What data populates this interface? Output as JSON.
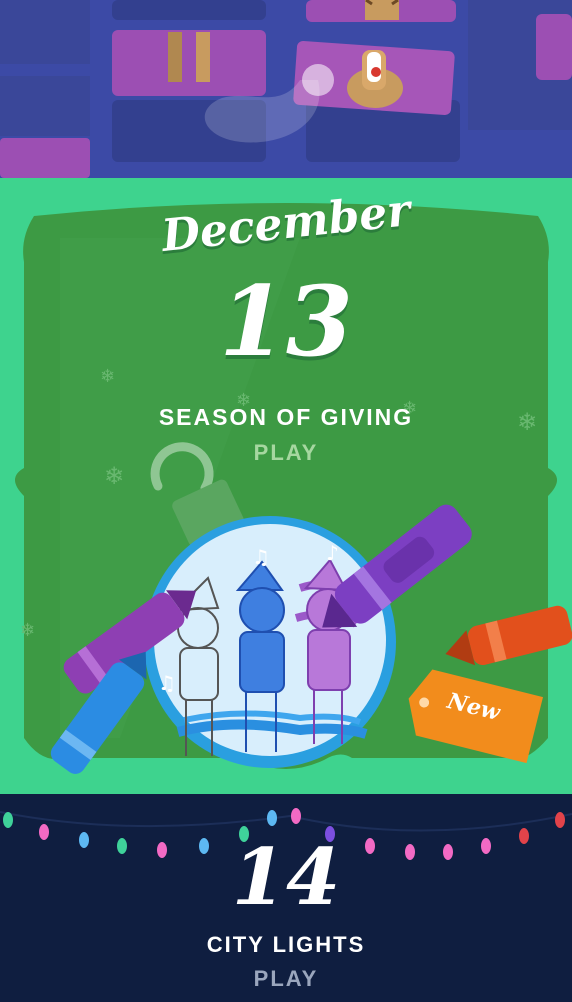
{
  "calendar": {
    "previous": {
      "icon": "reindeer-puzzle-icon"
    },
    "today": {
      "month": "December",
      "day": "13",
      "title": "SEASON OF GIVING",
      "action": "PLAY",
      "badge": "New",
      "icon": "snow-globe-elves-icon"
    },
    "next": {
      "day": "14",
      "title": "CITY LIGHTS",
      "action": "PLAY",
      "icon": "string-lights-icon"
    }
  },
  "colors": {
    "previous_bg": "#3c4aa6",
    "today_bg": "#3ed38e",
    "today_panel": "#3d9a44",
    "next_bg": "#0f1e40",
    "badge": "#f28c1c"
  }
}
